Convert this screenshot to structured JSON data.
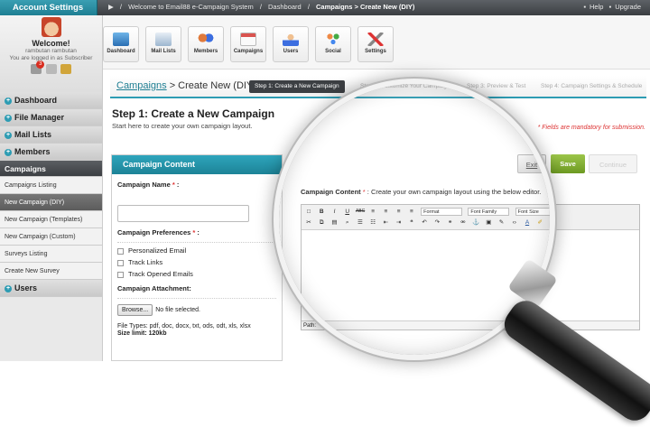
{
  "topbar": {
    "account_settings": "Account Settings",
    "crumbs": [
      "Welcome to Email88 e-Campaign System",
      "Dashboard"
    ],
    "crumb_current": "Campaigns > Create New (DIY)",
    "separator": "/",
    "help": "Help",
    "upgrade": "Upgrade"
  },
  "profile": {
    "welcome": "Welcome!",
    "name": "rambutan rambutan",
    "status": "You are logged in as Subscriber",
    "badge": "3"
  },
  "nav": {
    "dashboard": "Dashboard",
    "file_manager": "File Manager",
    "mail_lists": "Mail Lists",
    "members": "Members",
    "campaigns": "Campaigns",
    "campaigns_listing": "Campaigns Listing",
    "new_diy": "New Campaign (DIY)",
    "new_templates": "New Campaign (Templates)",
    "new_custom": "New Campaign (Custom)",
    "surveys_listing": "Surveys Listing",
    "create_survey": "Create New Survey",
    "users": "Users",
    "plus": "+"
  },
  "toolbar": [
    "Dashboard",
    "Mail Lists",
    "Members",
    "Campaigns",
    "Users",
    "Social",
    "Settings"
  ],
  "steps": {
    "campaigns_link": "Campaigns",
    "title_rest": " > Create New (DIY)",
    "step1": "Step 1: Create a New Campaign",
    "step2": "Step 2: Customize Your Campaign",
    "step3": "Step 3: Preview & Test",
    "step4": "Step 4: Campaign Settings & Schedule"
  },
  "main": {
    "heading": "Step 1: Create a New Campaign",
    "intro": "Start here to create your own campaign layout.",
    "mandatory": "* Fields are mandatory for submission."
  },
  "form": {
    "box_title": "Campaign Content",
    "name_label": "Campaign Name",
    "req": "*",
    "colon": ":",
    "prefs_label": "Campaign Preferences",
    "pref1": "Personalized Email",
    "pref2": "Track Links",
    "pref3": "Track Opened Emails",
    "attach_label": "Campaign Attachment:",
    "browse": "Browse...",
    "no_file": "No file selected.",
    "file_types": "File Types: pdf, doc, docx, txt, ods, odt, xls, xlsx",
    "size_limit": "Size limit: 120kb"
  },
  "actions": {
    "exit": "Exit",
    "save": "Save",
    "continue": "Continue"
  },
  "editor": {
    "label": "Campaign Content",
    "hint": " : Create your own campaign layout using the below editor.",
    "format": "Format",
    "font_family": "Font Family",
    "font_size": "Font Size",
    "path": "Path:",
    "bold": "B",
    "italic": "I",
    "underline": "U",
    "strike": "ABC",
    "font_color": "A"
  }
}
